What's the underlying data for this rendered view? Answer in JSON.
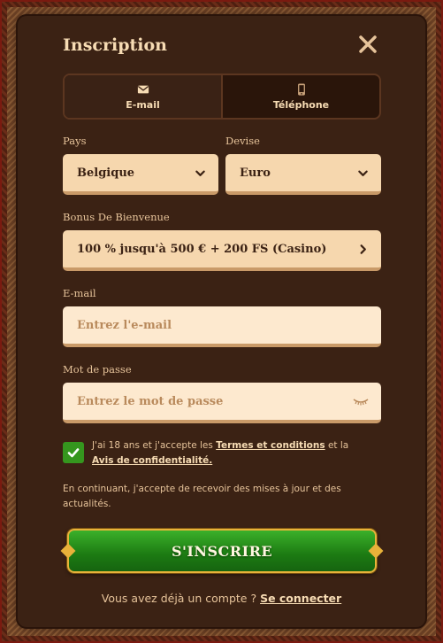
{
  "title": "Inscription",
  "tabs": [
    {
      "label": "E-mail",
      "icon": "envelope-icon",
      "active": true
    },
    {
      "label": "Téléphone",
      "icon": "phone-icon",
      "active": false
    }
  ],
  "country": {
    "label": "Pays",
    "value": "Belgique"
  },
  "currency": {
    "label": "Devise",
    "value": "Euro"
  },
  "bonus": {
    "label": "Bonus De Bienvenue",
    "value": "100 % jusqu'à 500 € + 200 FS (Casino)"
  },
  "email": {
    "label": "E-mail",
    "placeholder": "Entrez l'e-mail",
    "value": ""
  },
  "password": {
    "label": "Mot de passe",
    "placeholder": "Entrez le mot de passe",
    "value": ""
  },
  "terms": {
    "checked": true,
    "prefix": "J'ai 18 ans et j'accepte les ",
    "terms_link": "Termes et conditions",
    "middle": " et la",
    "privacy_link": "Avis de confidentialité."
  },
  "updates_text": "En continuant, j'accepte de recevoir des mises à jour et des actualités.",
  "signup_label": "S'INSCRIRE",
  "login": {
    "prompt": "Vous avez déjà un compte ? ",
    "link": "Se connecter"
  },
  "colors": {
    "background": "#3b2214",
    "field": "#f6d7ae",
    "accent_green": "#35961e",
    "gold": "#e8b23a",
    "text": "#f7dcb4"
  }
}
